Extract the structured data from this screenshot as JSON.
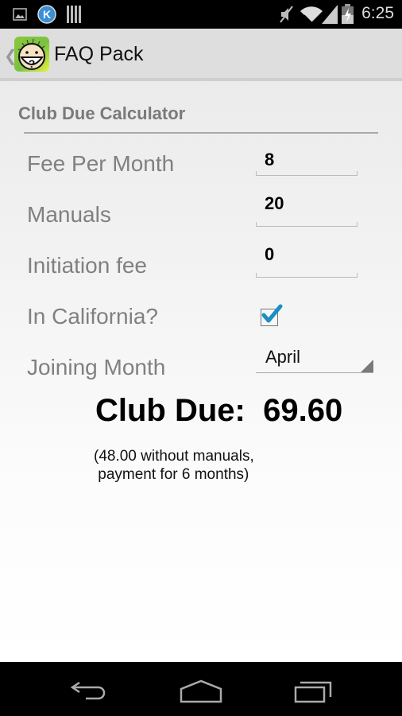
{
  "status_bar": {
    "left_icons": [
      "gallery-notification-icon",
      "k-app-notification-icon",
      "barcode-notification-icon"
    ],
    "right_icons": [
      "mute-icon",
      "wifi-icon",
      "signal-icon",
      "battery-charging-icon"
    ],
    "time": "6:25"
  },
  "action_bar": {
    "title": "FAQ Pack"
  },
  "form": {
    "section_title": "Club Due Calculator",
    "fields": [
      {
        "label": "Fee Per Month",
        "value": "8"
      },
      {
        "label": "Manuals",
        "value": "20"
      },
      {
        "label": "Initiation fee",
        "value": "0"
      }
    ],
    "california": {
      "label": "In California?",
      "checked": true
    },
    "joining_month": {
      "label": "Joining Month",
      "value": "April"
    }
  },
  "result": {
    "label": "Club Due:",
    "value": "69.60",
    "note_line1": "(48.00 without manuals,",
    "note_line2": " payment for 6 months)"
  },
  "colors": {
    "accent": "#33b5e5",
    "app_icon_green": "#7cc242"
  },
  "nav_bar": {
    "buttons": [
      "back",
      "home",
      "recents"
    ]
  }
}
